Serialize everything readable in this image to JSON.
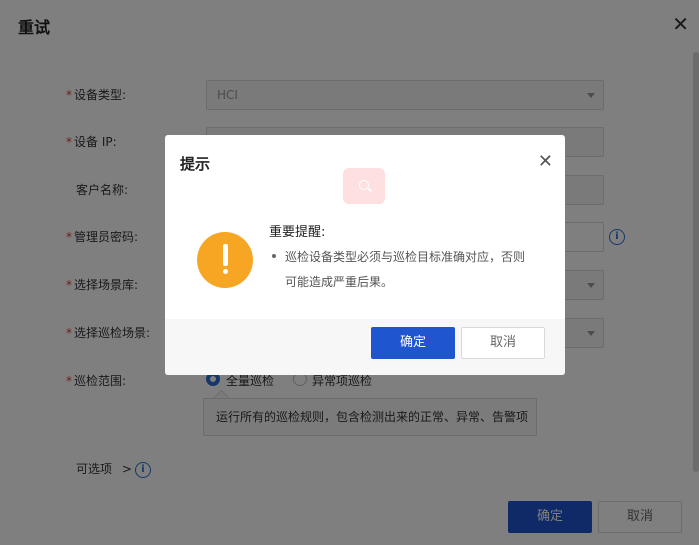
{
  "panel": {
    "title": "重试",
    "close_icon": "close-icon",
    "fields": {
      "device_type": {
        "label": "设备类型:",
        "value": "HCI",
        "required": true
      },
      "device_ip": {
        "label": "设备 IP:",
        "value": "",
        "required": true
      },
      "customer_name": {
        "label": "客户名称:",
        "value": "",
        "required": false
      },
      "admin_password": {
        "label": "管理员密码:",
        "value": "",
        "required": true
      },
      "scene_library": {
        "label": "选择场景库:",
        "value": "",
        "required": true
      },
      "inspection_scene": {
        "label": "选择巡检场景:",
        "value": "",
        "required": true
      },
      "inspection_range": {
        "label": "巡检范围:",
        "required": true,
        "options": [
          {
            "label": "全量巡检",
            "checked": true
          },
          {
            "label": "异常项巡检",
            "checked": false
          }
        ],
        "hint": "运行所有的巡检规则，包含检测出来的正常、异常、告警项"
      }
    },
    "optional_label": "可选项",
    "chevron": ">",
    "confirm_label": "确定",
    "cancel_label": "取消"
  },
  "modal": {
    "title": "提示",
    "close_icon": "close-icon",
    "heading": "重要提醒:",
    "message_line1": "巡检设备类型必须与巡检目标准确对应，否则",
    "message_line2": "可能造成严重后果。",
    "confirm_label": "确定",
    "cancel_label": "取消",
    "warning_icon": "exclamation-icon",
    "search_icon": "search-icon"
  },
  "colors": {
    "primary": "#1f55cf",
    "warning": "#f7a623",
    "required": "#e53935",
    "info": "#2b6fd6"
  }
}
